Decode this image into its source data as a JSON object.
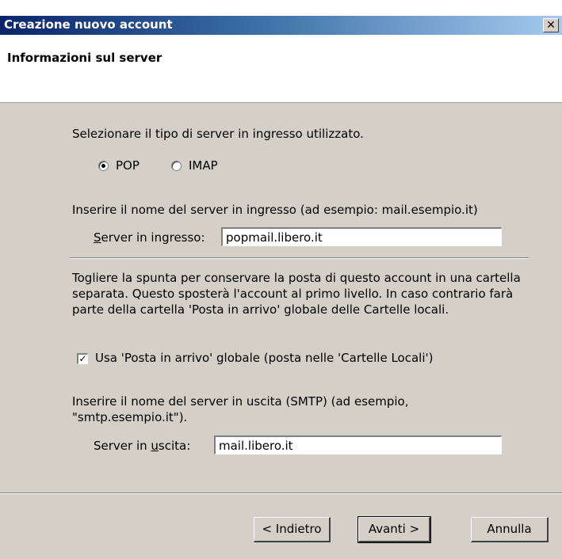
{
  "window": {
    "title": "Creazione nuovo account",
    "close_glyph": "✕"
  },
  "header": {
    "title": "Informazioni sul server"
  },
  "incoming_type": {
    "prompt": "Selezionare il tipo di server in ingresso utilizzato.",
    "options": [
      {
        "label": "POP",
        "selected": true
      },
      {
        "label": "IMAP",
        "selected": false
      }
    ]
  },
  "incoming_server": {
    "prompt": "Inserire il nome del server in ingresso (ad esempio: mail.esempio.it)",
    "label_prefix": "S",
    "label_rest": "erver in ingresso:",
    "value": "popmail.libero.it"
  },
  "global_inbox": {
    "description": "Togliere la spunta per conservare la posta di questo account in una cartella separata. Questo sposterà l'account al primo livello. In caso contrario farà parte della cartella 'Posta in arrivo' globale delle Cartelle locali.",
    "checkbox_label": "Usa 'Posta in arrivo' globale (posta nelle 'Cartelle Locali')",
    "checked": true
  },
  "outgoing_server": {
    "prompt": "Inserire il nome del server in uscita (SMTP) (ad esempio, \"smtp.esempio.it\").",
    "label_before": "Server in ",
    "label_underlined": "u",
    "label_after": "scita:",
    "value": "mail.libero.it"
  },
  "buttons": {
    "back": "< Indietro",
    "next": "Avanti >",
    "cancel": "Annulla"
  }
}
